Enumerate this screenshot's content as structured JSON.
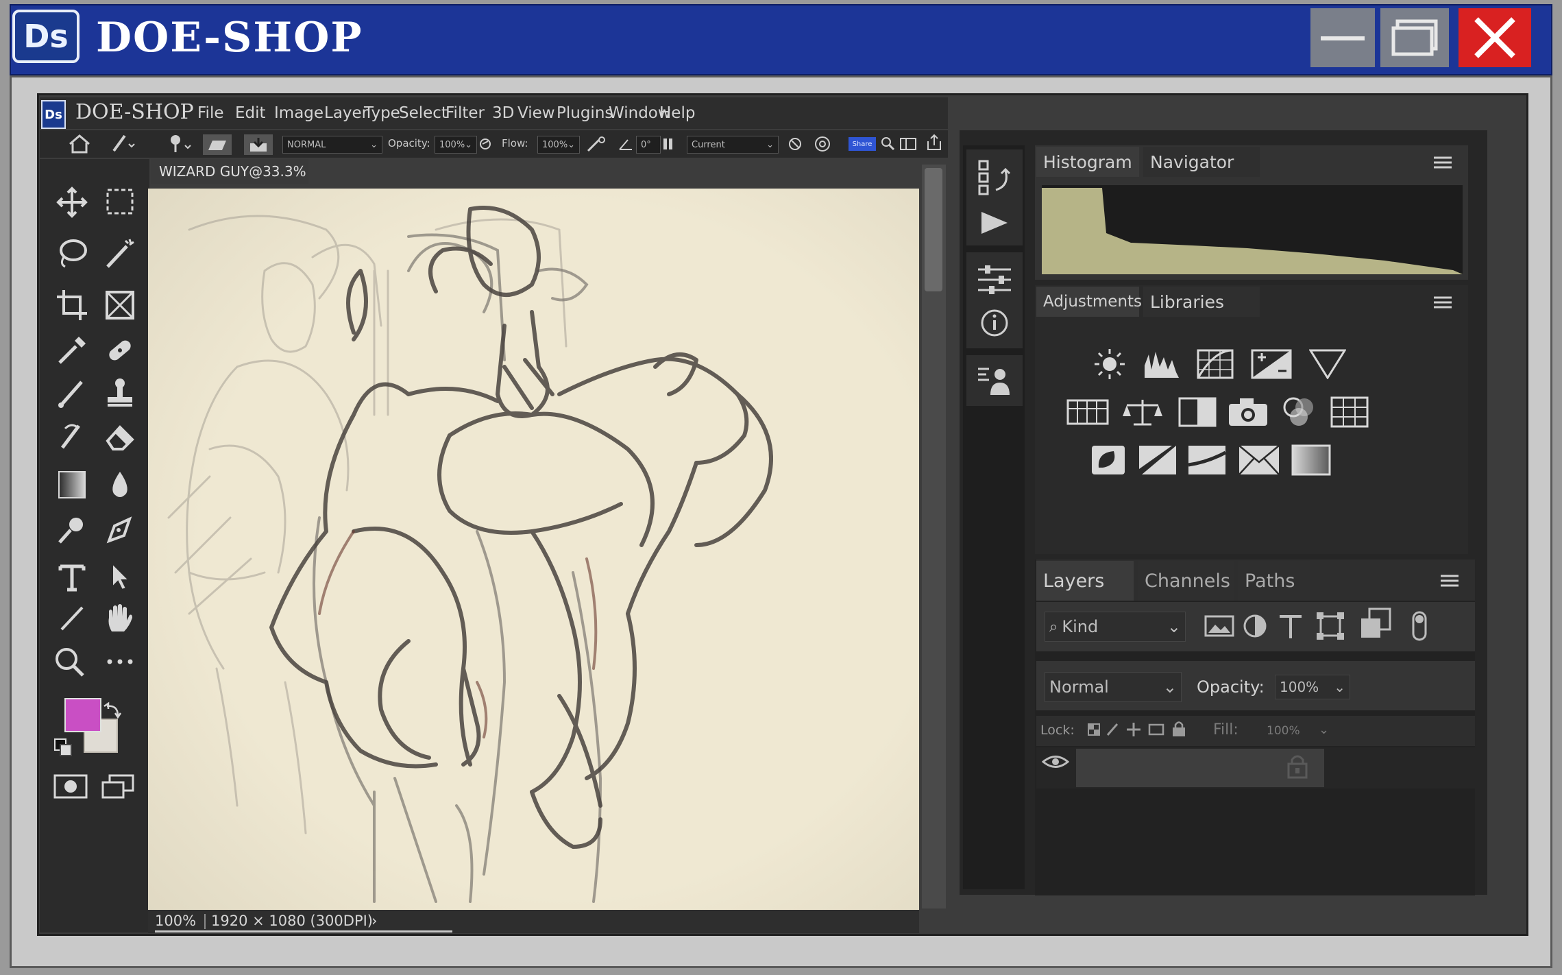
{
  "window": {
    "title": "DOE-SHOP",
    "logo": "Ds",
    "controls": [
      "minimize-icon",
      "maximize-icon",
      "close-icon"
    ]
  },
  "app": {
    "logo": "Ds",
    "title": "DOE-SHOP",
    "menu": [
      "File",
      "Edit",
      "Image",
      "Layer",
      "Type",
      "Select",
      "Filter",
      "3D",
      "View",
      "Plugins",
      "Window",
      "Help"
    ]
  },
  "options": {
    "blend_mode": "NORMAL",
    "opacity_label": "Opacity:",
    "opacity_value": "100%",
    "flow_label": "Flow:",
    "flow_value": "100%",
    "angle_value": "0°",
    "sample": "Current",
    "share_label": "Share"
  },
  "document": {
    "tab_title": "WIZARD GUY@33.3%",
    "zoom": "100%",
    "dimensions": "1920 × 1080 (300DPI)"
  },
  "panels": {
    "top_tabs": [
      "Histogram",
      "Navigator"
    ],
    "adj_tabs": [
      "Adjustments",
      "Libraries"
    ],
    "layers_tabs": [
      "Layers",
      "Channels",
      "Paths"
    ],
    "filter_kind": "Kind",
    "blend_mode": "Normal",
    "opacity_label": "Opacity:",
    "opacity_value": "100%",
    "lock_label": "Lock:",
    "fill_label": "Fill:",
    "fill_value": "100%"
  },
  "colors": {
    "title_bar": "#1c3597",
    "close": "#d92121",
    "foreground": "#c94fc4",
    "background": "#e0dcd4",
    "histogram": "#b6b487"
  }
}
